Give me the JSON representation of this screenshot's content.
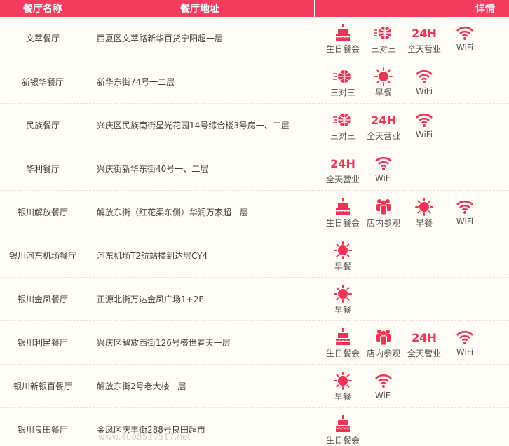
{
  "header": {
    "col_name": "餐厅名称",
    "col_addr": "餐厅地址",
    "col_detail": "详情"
  },
  "colors": {
    "accent": "#f43c61",
    "icon": "#ee3455"
  },
  "feature_labels": {
    "birthday": "生日餐会",
    "basketball": "三对三",
    "24h": "全天营业",
    "wifi": "WiFi",
    "breakfast": "早餐",
    "tour": "店内参观"
  },
  "icon_text_24h": "24H",
  "rows": [
    {
      "name": "文萃餐厅",
      "address": "西夏区文萃路新华百货宁阳超一层",
      "features": [
        "birthday",
        "basketball",
        "24h",
        "wifi"
      ]
    },
    {
      "name": "新银华餐厅",
      "address": "新华东街74号一二层",
      "features": [
        "basketball",
        "breakfast",
        "wifi"
      ]
    },
    {
      "name": "民族餐厅",
      "address": "兴庆区民族南街星光花园14号综合楼3号房一、二层",
      "features": [
        "basketball",
        "24h",
        "wifi"
      ]
    },
    {
      "name": "华利餐厅",
      "address": "兴庆街新华东街40号一、二层",
      "features": [
        "24h",
        "wifi"
      ]
    },
    {
      "name": "银川解放餐厅",
      "address": "解放东街（红花渠东侧）华润万家超一层",
      "features": [
        "birthday",
        "tour",
        "breakfast",
        "wifi"
      ]
    },
    {
      "name": "银川河东机场餐厅",
      "address": "河东机场T2航站楼到达层CY4",
      "features": [
        "breakfast"
      ]
    },
    {
      "name": "银川金凤餐厅",
      "address": "正源北街万达金凤广场1+2F",
      "features": [
        "breakfast"
      ]
    },
    {
      "name": "银川利民餐厅",
      "address": "兴庆区解放西街126号盛世春天一层",
      "features": [
        "birthday",
        "tour",
        "24h",
        "wifi"
      ]
    },
    {
      "name": "银川新银百餐厅",
      "address": "解放东街2号老大楼一层",
      "features": [
        "breakfast",
        "wifi"
      ]
    },
    {
      "name": "银川良田餐厅",
      "address": "金凤区庆丰街288号良田超市",
      "features": [
        "birthday"
      ]
    }
  ],
  "watermark": "www.4008517517.net"
}
